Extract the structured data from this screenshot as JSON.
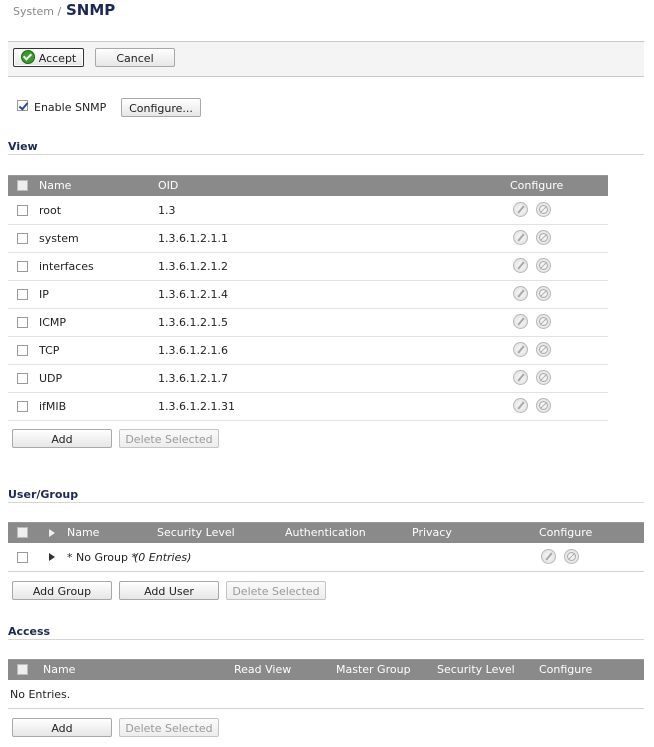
{
  "header": {
    "breadcrumb": "System /",
    "title": "SNMP"
  },
  "toolbar": {
    "accept_label": "Accept",
    "cancel_label": "Cancel"
  },
  "snmp": {
    "enable_label": "Enable SNMP",
    "enabled": true,
    "configure_label": "Configure..."
  },
  "view": {
    "title": "View",
    "columns": {
      "name": "Name",
      "oid": "OID",
      "configure": "Configure"
    },
    "rows": [
      {
        "name": "root",
        "oid": "1.3"
      },
      {
        "name": "system",
        "oid": "1.3.6.1.2.1.1"
      },
      {
        "name": "interfaces",
        "oid": "1.3.6.1.2.1.2"
      },
      {
        "name": "IP",
        "oid": "1.3.6.1.2.1.4"
      },
      {
        "name": "ICMP",
        "oid": "1.3.6.1.2.1.5"
      },
      {
        "name": "TCP",
        "oid": "1.3.6.1.2.1.6"
      },
      {
        "name": "UDP",
        "oid": "1.3.6.1.2.1.7"
      },
      {
        "name": "ifMIB",
        "oid": "1.3.6.1.2.1.31"
      }
    ],
    "add_label": "Add",
    "delete_label": "Delete Selected"
  },
  "user_group": {
    "title": "User/Group",
    "columns": {
      "name": "Name",
      "security": "Security Level",
      "auth": "Authentication",
      "privacy": "Privacy",
      "configure": "Configure"
    },
    "rows": [
      {
        "name": "* No Group *",
        "entries": "(0 Entries)"
      }
    ],
    "add_group_label": "Add Group",
    "add_user_label": "Add User",
    "delete_label": "Delete Selected"
  },
  "access": {
    "title": "Access",
    "columns": {
      "name": "Name",
      "read_view": "Read View",
      "master_group": "Master Group",
      "security": "Security Level",
      "configure": "Configure"
    },
    "empty_text": "No Entries.",
    "add_label": "Add",
    "delete_label": "Delete Selected"
  }
}
